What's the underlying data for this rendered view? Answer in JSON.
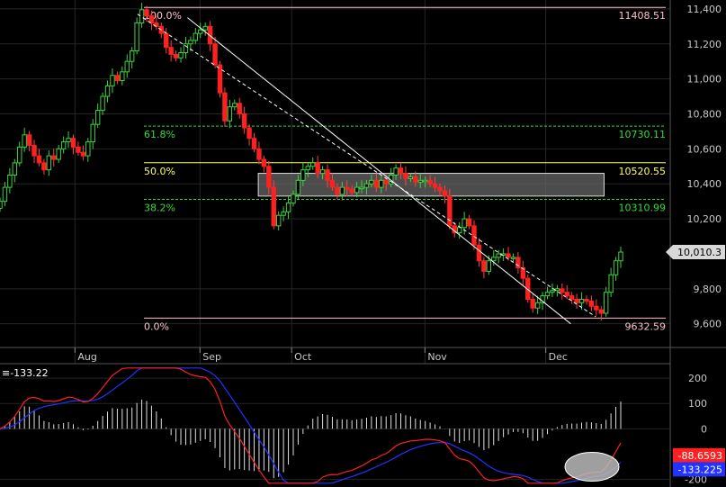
{
  "chart_data": [
    {
      "type": "candlestick",
      "ylim": [
        9480,
        11420
      ],
      "y_ticks": [
        11400,
        11200,
        11000,
        10800,
        10600,
        10400,
        10200,
        9800,
        9600
      ],
      "y_tick_labels": [
        "11,400",
        "11,200",
        "11,000",
        "10,800",
        "10,600",
        "10,400",
        "10,200",
        "9,800",
        "9,600"
      ],
      "x_labels": [
        "Aug",
        "Sep",
        "Oct",
        "Nov",
        "Dec"
      ],
      "x_label_bars": [
        18,
        48,
        70,
        102,
        131
      ],
      "bars": 150,
      "last_price": 10010.3,
      "last_price_label": "10,010.3",
      "fibonacci": [
        {
          "label": "100.0%",
          "value": 11408.51,
          "value_label": "11408.51",
          "color": "#ffc0cb"
        },
        {
          "label": "61.8%",
          "value": 10730.11,
          "value_label": "10730.11",
          "color": "#33dd33"
        },
        {
          "label": "50.0%",
          "value": 10520.55,
          "value_label": "10520.55",
          "color": "#ffff66"
        },
        {
          "label": "38.2%",
          "value": 10310.99,
          "value_label": "10310.99",
          "color": "#33dd33"
        },
        {
          "label": "0.0%",
          "value": 9632.59,
          "value_label": "9632.59",
          "color": "#ffc0cb"
        }
      ],
      "resistance_zone": {
        "from_bar": 62,
        "to_bar": 145,
        "low": 10330,
        "high": 10460
      },
      "trendlines": [
        {
          "style": "solid",
          "from_bar": 45,
          "from_value": 11350,
          "to_bar": 137,
          "to_value": 9600
        },
        {
          "style": "dashed",
          "from_bar": 33,
          "from_value": 11370,
          "to_bar": 143,
          "to_value": 9640
        }
      ],
      "closes": [
        10300,
        10380,
        10450,
        10520,
        10610,
        10680,
        10620,
        10560,
        10520,
        10480,
        10560,
        10540,
        10600,
        10640,
        10660,
        10610,
        10580,
        10560,
        10640,
        10740,
        10820,
        10900,
        10960,
        11020,
        10990,
        11040,
        11100,
        11160,
        11320,
        11395,
        11360,
        11320,
        11300,
        11260,
        11180,
        11140,
        11120,
        11150,
        11200,
        11220,
        11260,
        11280,
        11300,
        11200,
        11080,
        10920,
        10760,
        10840,
        10860,
        10800,
        10720,
        10660,
        10600,
        10540,
        10500,
        10380,
        10160,
        10220,
        10240,
        10290,
        10340,
        10420,
        10480,
        10500,
        10520,
        10460,
        10480,
        10420,
        10380,
        10340,
        10380,
        10370,
        10350,
        10380,
        10380,
        10400,
        10420,
        10380,
        10420,
        10400,
        10450,
        10490,
        10460,
        10430,
        10440,
        10410,
        10420,
        10420,
        10400,
        10380,
        10360,
        10330,
        10160,
        10120,
        10150,
        10200,
        10160,
        10050,
        9960,
        9900,
        9960,
        9980,
        10000,
        10000,
        9980,
        9980,
        9920,
        9860,
        9740,
        9690,
        9720,
        9760,
        9780,
        9790,
        9800,
        9780,
        9760,
        9740,
        9720,
        9740,
        9730,
        9700,
        9680,
        9660,
        9780,
        9880,
        9960,
        10010
      ],
      "panel2": {
        "title": "-133.22",
        "ylim": [
          -230,
          250
        ],
        "y_ticks": [
          200,
          100,
          0,
          -200
        ],
        "y_tick_labels": [
          "200",
          "100",
          "0",
          "-200"
        ],
        "series": [
          {
            "value": 88.6593,
            "value_label": "-88.6593",
            "color": "#ff2020"
          },
          {
            "value": -133.225,
            "value_label": "-133.225",
            "color": "#2233ff"
          }
        ]
      }
    }
  ]
}
